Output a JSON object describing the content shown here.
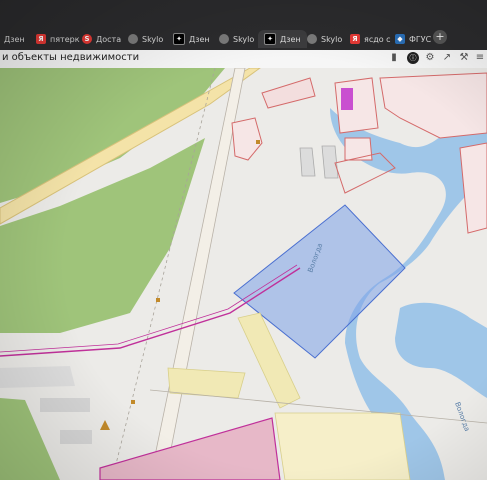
{
  "tabs": [
    {
      "label": "Дзен",
      "icon": "none"
    },
    {
      "label": "пятерк",
      "icon": "yandex-icon",
      "color": "#e53935"
    },
    {
      "label": "Доста",
      "icon": "dostavka-icon",
      "color": "#e53935"
    },
    {
      "label": "Skylo",
      "icon": "skylo-icon",
      "color": "#7a7a7a"
    },
    {
      "label": "Дзен",
      "icon": "dzen-icon",
      "color": "#000000"
    },
    {
      "label": "Skylo",
      "icon": "skylo-icon",
      "color": "#7a7a7a"
    },
    {
      "label": "Дзен",
      "icon": "dzen-icon",
      "color": "#000000"
    },
    {
      "label": "Skylo",
      "icon": "skylo-icon",
      "color": "#7a7a7a"
    },
    {
      "label": "ясдо с",
      "icon": "yandex-icon",
      "color": "#e53935"
    },
    {
      "label": "ФГУС",
      "icon": "fgus-icon",
      "color": "#2a6fb8"
    }
  ],
  "new_tab_symbol": "+",
  "page": {
    "title": "и объекты недвижимости"
  },
  "map": {
    "labels": {
      "river_upper": "Вологда",
      "river_lower": "Вологда"
    },
    "colors": {
      "forest": "#9fc47a",
      "water": "#9fc6e8",
      "parcel": "#d46a6a",
      "selected_area": "#7ea2e8",
      "zone_pink": "#e7b8c8",
      "zone_yellow": "#f1e9b5",
      "road": "#f4e3a8",
      "magenta_line": "#c0309a"
    }
  }
}
